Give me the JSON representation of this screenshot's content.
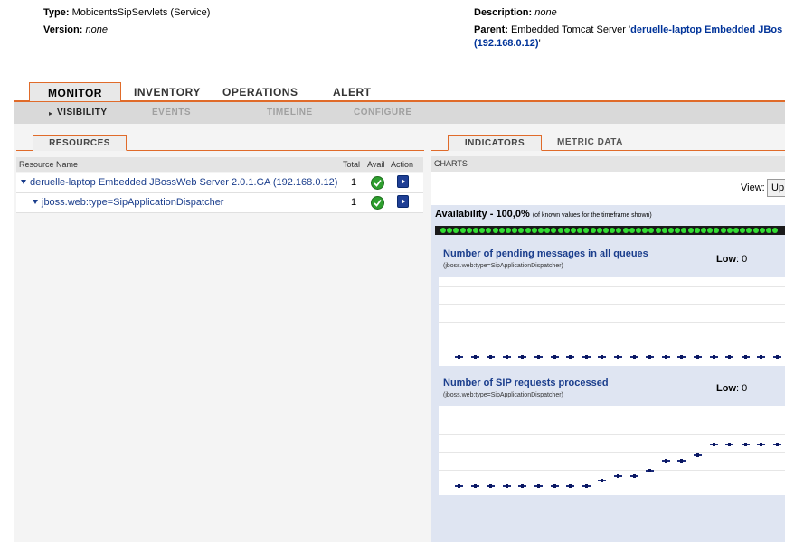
{
  "meta": {
    "type_label": "Type:",
    "type_value": "MobicentsSipServlets (Service)",
    "version_label": "Version:",
    "version_value": "none",
    "description_label": "Description:",
    "description_value": "none",
    "parent_label": "Parent:",
    "parent_prefix": "Embedded Tomcat Server '",
    "parent_link_line1": "deruelle-laptop Embedded JBos",
    "parent_link_line2": "(192.168.0.12)",
    "parent_suffix": "'"
  },
  "main_tabs": [
    {
      "label": "MONITOR",
      "active": true
    },
    {
      "label": "INVENTORY",
      "active": false
    },
    {
      "label": "OPERATIONS",
      "active": false
    },
    {
      "label": "ALERT",
      "active": false
    }
  ],
  "sub_tabs": [
    {
      "label": "VISIBILITY",
      "active": true
    },
    {
      "label": "EVENTS",
      "active": false
    },
    {
      "label": "TIMELINE",
      "active": false
    },
    {
      "label": "CONFIGURE",
      "active": false
    }
  ],
  "left_panel": {
    "tab_label": "RESOURCES",
    "columns": [
      "Resource Name",
      "Total",
      "Avail",
      "Action"
    ],
    "rows": [
      {
        "name": "deruelle-laptop Embedded JBossWeb Server 2.0.1.GA (192.168.0.12)",
        "total": "1",
        "avail": "up"
      },
      {
        "name": "jboss.web:type=SipApplicationDispatcher",
        "total": "1",
        "avail": "up"
      }
    ]
  },
  "right_panel": {
    "tabs": [
      {
        "label": "INDICATORS",
        "active": true
      },
      {
        "label": "METRIC DATA",
        "active": false
      }
    ],
    "charts_header": "CHARTS",
    "view_label": "View:",
    "view_value": "Up",
    "availability_label": "Availability - 100,0%",
    "availability_note": "(of known values for the timeframe shown)",
    "availability_dot_color": "#33dd33",
    "availability_percent": 100,
    "charts": [
      {
        "title": "Number of pending messages in all queues",
        "subtitle": "(jboss.web:type=SipApplicationDispatcher)",
        "low_label": "Low",
        "low_value": ": 0",
        "points": [
          0,
          0,
          0,
          0,
          0,
          0,
          0,
          0,
          0,
          0,
          0,
          0,
          0,
          0,
          0,
          0,
          0,
          0,
          0,
          0,
          0
        ]
      },
      {
        "title": "Number of SIP requests processed",
        "subtitle": "(jboss.web:type=SipApplicationDispatcher)",
        "low_label": "Low",
        "low_value": ": 0",
        "points": [
          0,
          0,
          0,
          0,
          0,
          0,
          0,
          0,
          0,
          1,
          2,
          2,
          3,
          5,
          5,
          6,
          8,
          8,
          8,
          8,
          8
        ]
      }
    ]
  }
}
